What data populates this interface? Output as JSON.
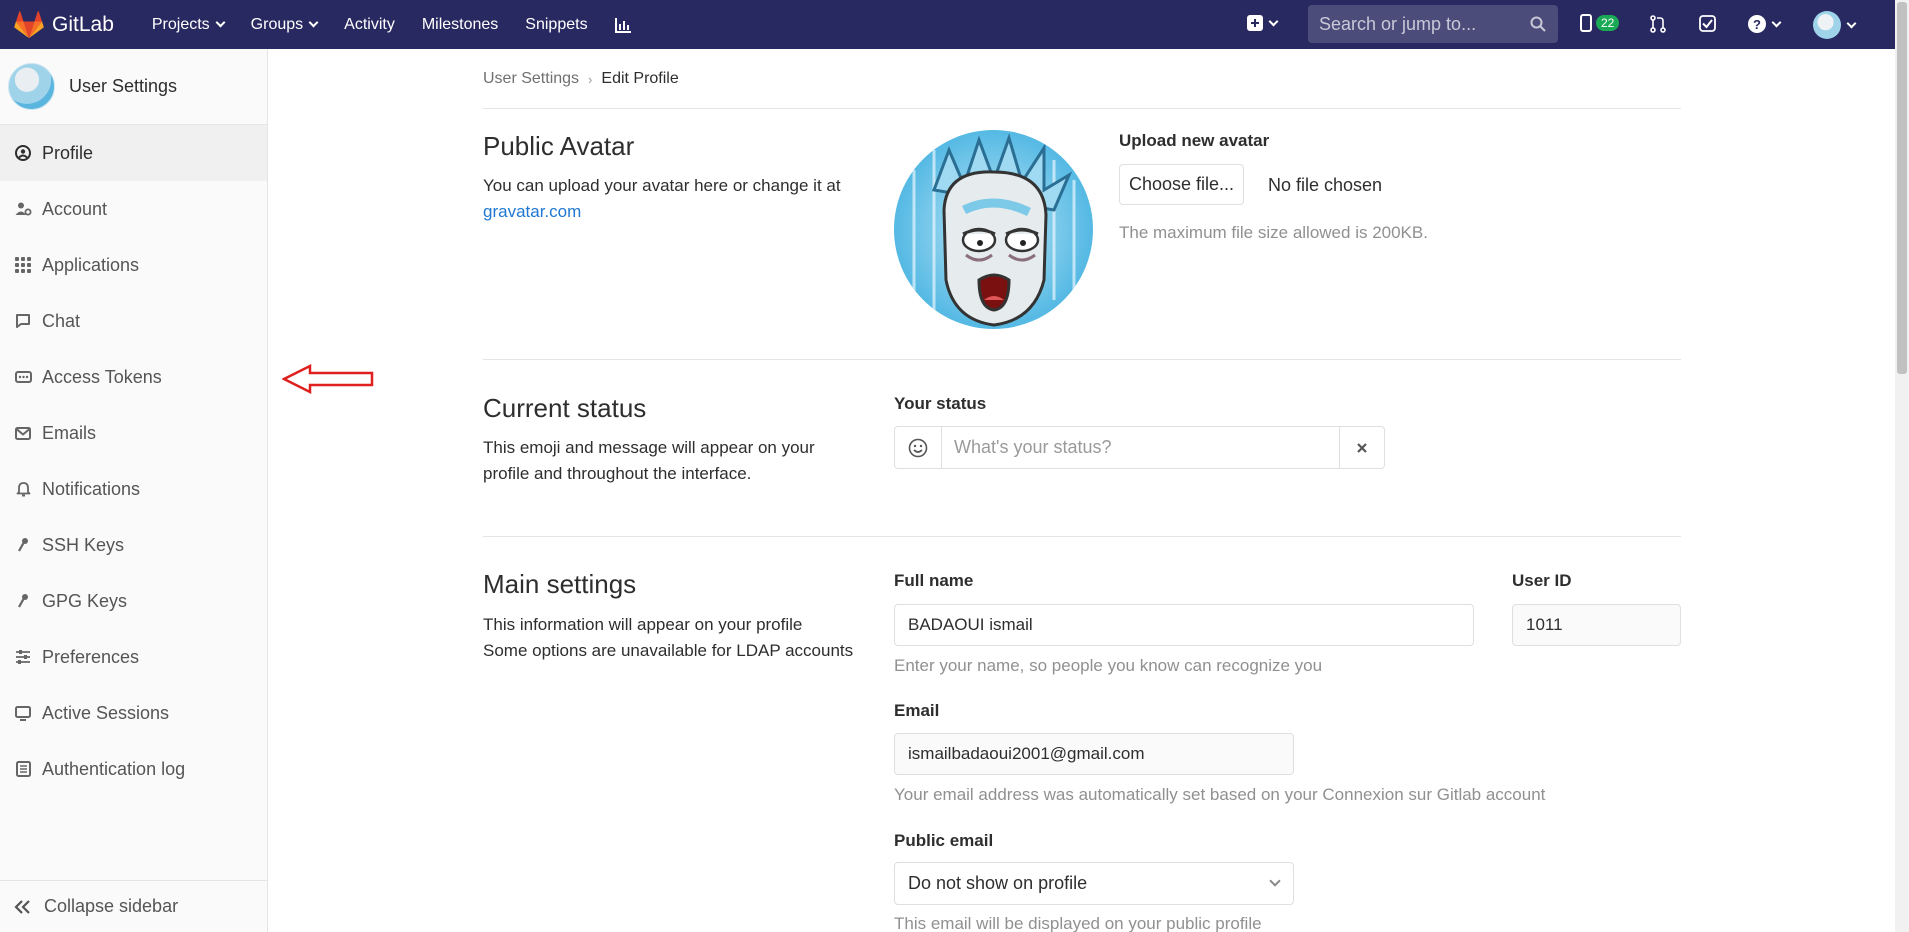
{
  "navbar": {
    "brand": "GitLab",
    "links": [
      {
        "label": "Projects",
        "has_caret": true
      },
      {
        "label": "Groups",
        "has_caret": true
      },
      {
        "label": "Activity",
        "has_caret": false
      },
      {
        "label": "Milestones",
        "has_caret": false
      },
      {
        "label": "Snippets",
        "has_caret": false
      }
    ],
    "search_placeholder": "Search or jump to...",
    "issues_count": "22",
    "colors": {
      "bg": "#292961",
      "badge": "#1aaa55"
    }
  },
  "sidebar": {
    "title": "User Settings",
    "items": [
      {
        "label": "Profile",
        "icon": "profile-icon",
        "active": true
      },
      {
        "label": "Account",
        "icon": "account-gear-icon"
      },
      {
        "label": "Applications",
        "icon": "applications-grid-icon"
      },
      {
        "label": "Chat",
        "icon": "chat-icon"
      },
      {
        "label": "Access Tokens",
        "icon": "token-icon"
      },
      {
        "label": "Emails",
        "icon": "envelope-icon"
      },
      {
        "label": "Notifications",
        "icon": "bell-icon"
      },
      {
        "label": "SSH Keys",
        "icon": "key-icon"
      },
      {
        "label": "GPG Keys",
        "icon": "key-icon"
      },
      {
        "label": "Preferences",
        "icon": "sliders-icon"
      },
      {
        "label": "Active Sessions",
        "icon": "monitor-icon"
      },
      {
        "label": "Authentication log",
        "icon": "list-icon"
      }
    ],
    "collapse": "Collapse sidebar"
  },
  "breadcrumb": {
    "parent": "User Settings",
    "current": "Edit Profile"
  },
  "avatar_section": {
    "title": "Public Avatar",
    "desc": "You can upload your avatar here or change it at",
    "link": "gravatar.com",
    "upload_label": "Upload new avatar",
    "choose_button": "Choose file...",
    "no_file": "No file chosen",
    "max_size_hint": "The maximum file size allowed is 200KB."
  },
  "status_section": {
    "title": "Current status",
    "desc": "This emoji and message will appear on your profile and throughout the interface.",
    "label": "Your status",
    "placeholder": "What's your status?"
  },
  "main_section": {
    "title": "Main settings",
    "desc_line1": "This information will appear on your profile",
    "desc_line2": "Some options are unavailable for LDAP accounts",
    "full_name_label": "Full name",
    "full_name_value": "BADAOUI ismail",
    "full_name_hint": "Enter your name, so people you know can recognize you",
    "user_id_label": "User ID",
    "user_id_value": "1011",
    "email_label": "Email",
    "email_value": "ismailbadaoui2001@gmail.com",
    "email_hint": "Your email address was automatically set based on your Connexion sur Gitlab account",
    "public_email_label": "Public email",
    "public_email_value": "Do not show on profile",
    "public_email_hint": "This email will be displayed on your public profile"
  }
}
